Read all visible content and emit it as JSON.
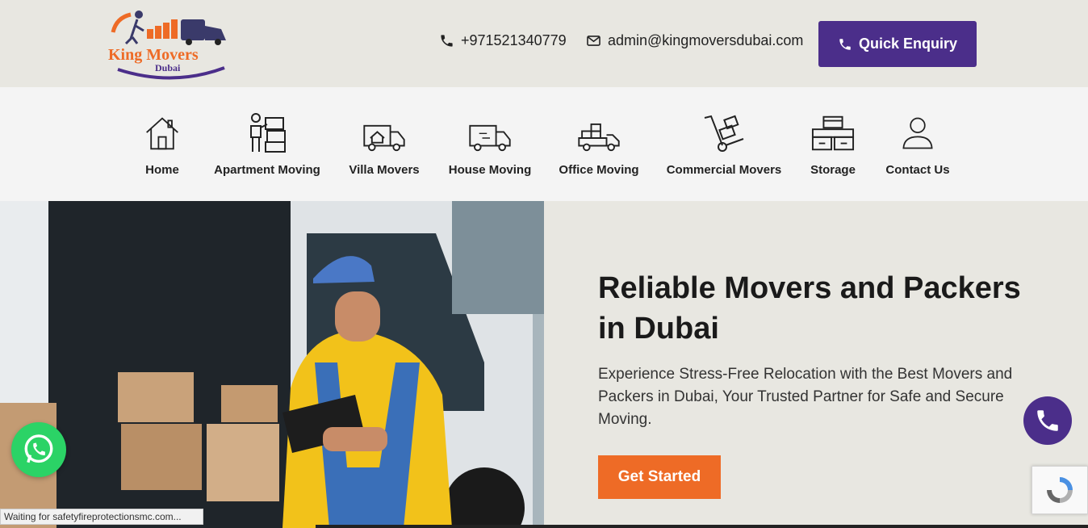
{
  "header": {
    "logo_line1": "King Movers",
    "logo_line2": "Dubai",
    "phone": "+971521340779",
    "email": "admin@kingmoversdubai.com",
    "enquiry_label": "Quick Enquiry",
    "colors": {
      "brand_purple": "#4b2e8a",
      "brand_orange": "#ee6b26"
    }
  },
  "nav": {
    "items": [
      {
        "label": "Home",
        "icon": "house-icon"
      },
      {
        "label": "Apartment Moving",
        "icon": "mover-boxes-icon"
      },
      {
        "label": "Villa Movers",
        "icon": "villa-truck-icon"
      },
      {
        "label": "House Moving",
        "icon": "moving-truck-icon"
      },
      {
        "label": "Office Moving",
        "icon": "loaded-truck-icon"
      },
      {
        "label": "Commercial Movers",
        "icon": "hand-truck-icon"
      },
      {
        "label": "Storage",
        "icon": "storage-boxes-icon"
      },
      {
        "label": "Contact Us",
        "icon": "user-icon"
      }
    ]
  },
  "hero": {
    "title": "Reliable Movers and Packers in Dubai",
    "subtitle": "Experience Stress-Free Relocation with the Best Movers and Packers in Dubai, Your Trusted Partner for Safe and Secure Moving.",
    "cta_label": "Get Started"
  },
  "browser": {
    "status_text": "Waiting for safetyfireprotectionsmc.com..."
  }
}
